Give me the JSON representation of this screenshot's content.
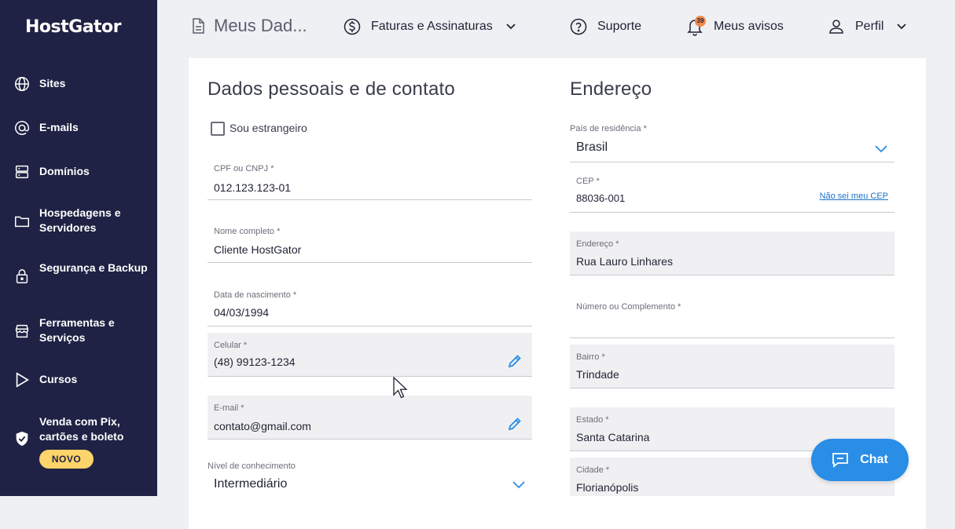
{
  "sidebar": {
    "logo": "HostGator",
    "items": [
      {
        "label": "Sites",
        "icon": "globe-icon"
      },
      {
        "label": "E-mails",
        "icon": "at-icon"
      },
      {
        "label": "Domínios",
        "icon": "server-icon"
      },
      {
        "label": "Hospedagens e Servidores",
        "icon": "folder-icon"
      },
      {
        "label": "Segurança e Backup",
        "icon": "lock-icon"
      },
      {
        "label": "Ferramentas e Serviços",
        "icon": "store-icon"
      },
      {
        "label": "Cursos",
        "icon": "play-icon"
      },
      {
        "label": "Venda com Pix, cartões e boleto",
        "icon": "shield-check-icon"
      }
    ],
    "new_badge": "NOVO"
  },
  "topbar": {
    "page_title": "Meus Dad...",
    "invoices": "Faturas e Assinaturas",
    "support": "Suporte",
    "notifications": "Meus avisos",
    "notification_count": "39",
    "profile": "Perfil"
  },
  "personal": {
    "title": "Dados pessoais e de contato",
    "foreigner_label": "Sou estrangeiro",
    "cpf_label": "CPF ou CNPJ *",
    "cpf_value": "012.123.123-01",
    "name_label": "Nome completo *",
    "name_value": "Cliente HostGator",
    "birth_label": "Data de nascimento *",
    "birth_value": "04/03/1994",
    "phone_label": "Celular *",
    "phone_value": "(48) 99123-1234",
    "email_label": "E-mail *",
    "email_value": "contato@gmail.com",
    "level_label": "Nível de conhecimento",
    "level_value": "Intermediário"
  },
  "address": {
    "title": "Endereço",
    "country_label": "País de residência *",
    "country_value": "Brasil",
    "cep_label": "CEP *",
    "cep_value": "88036-001",
    "cep_link": "Não sei meu CEP",
    "street_label": "Endereço *",
    "street_value": "Rua Lauro Linhares",
    "number_label": "Número ou Complemento *",
    "number_value": "",
    "district_label": "Bairro *",
    "district_value": "Trindade",
    "state_label": "Estado *",
    "state_value": "Santa Catarina",
    "city_label": "Cidade *",
    "city_value": "Florianópolis"
  },
  "chat": {
    "label": "Chat"
  },
  "colors": {
    "sidebar": "#1f2244",
    "accent": "#2a8de6",
    "badge": "#ffd46b",
    "link": "#1a73c9"
  }
}
